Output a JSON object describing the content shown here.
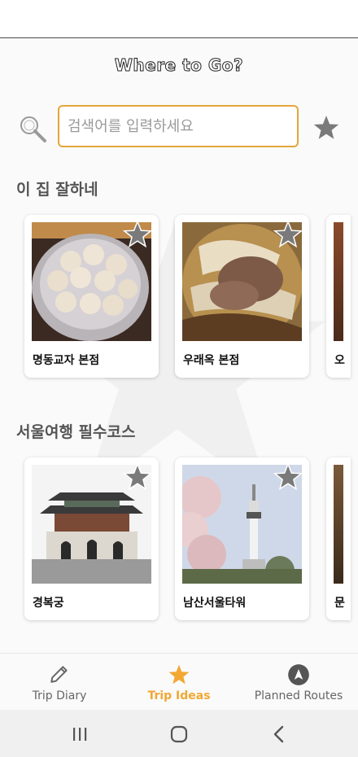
{
  "header": {
    "title": "Where to Go?"
  },
  "search": {
    "placeholder": "검색어를 입력하세요",
    "value": ""
  },
  "sections": [
    {
      "title": "이 집 잘하네",
      "cards": [
        {
          "name": "명동교자 본점"
        },
        {
          "name": "우래옥 본점"
        },
        {
          "name": "오"
        }
      ]
    },
    {
      "title": "서울여행 필수코스",
      "cards": [
        {
          "name": "경복궁"
        },
        {
          "name": "남산서울타워"
        },
        {
          "name": "문"
        }
      ]
    }
  ],
  "bottom_nav": {
    "items": [
      {
        "label": "Trip Diary",
        "icon": "pencil-icon"
      },
      {
        "label": "Trip Ideas",
        "icon": "star-icon",
        "active": true
      },
      {
        "label": "Planned Routes",
        "icon": "navigation-icon"
      }
    ]
  },
  "colors": {
    "accent": "#f2a833",
    "search_border": "#e4a63a",
    "star_gray": "#7a7a7a"
  }
}
